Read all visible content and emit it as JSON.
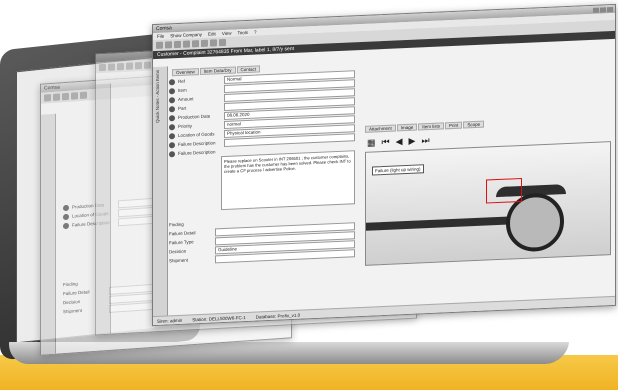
{
  "window": {
    "title": "Comsa",
    "menu": [
      "File",
      "Show Company",
      "Edit",
      "View",
      "Tools",
      "?"
    ],
    "header": "Customer - Complaint 32764835 From Mar, label 1, 8/7/y sent",
    "tabs": [
      "Overview",
      "Item Data/Dry",
      "Contact"
    ],
    "sidebar_label": "Quick Notes - Action Items"
  },
  "form": {
    "rows": [
      {
        "label": "Ref",
        "value": "Normal"
      },
      {
        "label": "Item",
        "value": ""
      },
      {
        "label": "Amount",
        "value": ""
      },
      {
        "label": "Part",
        "value": ""
      },
      {
        "label": "Production Date",
        "value": "08.06.2020"
      },
      {
        "label": "Priority",
        "value": "normal"
      },
      {
        "label": "Location of Goods",
        "value": "Physical location"
      },
      {
        "label": "Failure Description",
        "value": ""
      },
      {
        "label": "Failure Description",
        "value": ""
      }
    ],
    "failure_text": "Please replace on Scooter in INT 206501 ; the customer complains, the problem has the customer has been solved. Please check INT to create a CF process / advertise Police.",
    "finding_labels": [
      "Finding",
      "Failure Detail",
      "Failure Type",
      "Decision",
      "Shipment"
    ],
    "decision_value": "Guideline"
  },
  "photo": {
    "tabs": [
      "Attachment",
      "Image",
      "Item lists",
      "Print",
      "Scope",
      "Calendar",
      "Free Tasks"
    ],
    "callout": "Failure (light up wiring)"
  },
  "statusbar": {
    "user": "Siren: admin",
    "station": "Station: DELL500W6-FC-1",
    "db": "Database: Profix_v1.0"
  },
  "back_window": {
    "title": "Comsa",
    "labels": [
      "Production Date",
      "Location of Goods",
      "Failure Description",
      "Finding",
      "Failure Detail",
      "Decision",
      "Shipment"
    ]
  }
}
